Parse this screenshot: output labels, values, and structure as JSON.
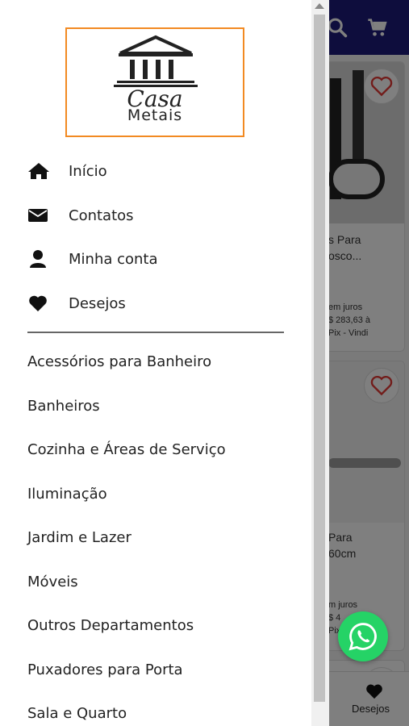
{
  "drawer": {
    "logo": {
      "line1": "Casa",
      "line2": "Metais",
      "border_color": "#f28a22"
    },
    "nav": [
      {
        "label": "Início",
        "icon": "home-icon"
      },
      {
        "label": "Contatos",
        "icon": "envelope-icon"
      },
      {
        "label": "Minha conta",
        "icon": "user-icon"
      },
      {
        "label": "Desejos",
        "icon": "heart-icon"
      }
    ],
    "categories": [
      "Acessórios para Banheiro",
      "Banheiros",
      "Cozinha e Áreas de Serviço",
      "Iluminação",
      "Jardim e Lazer",
      "Móveis",
      "Outros Departamentos",
      "Puxadores para Porta",
      "Sala e Quarto"
    ]
  },
  "background": {
    "header_color": "#1d1a7a",
    "card1": {
      "title_line1": "s Para",
      "title_line2": "osco...",
      "price_line1": "em juros",
      "price_line2": "$ 283,63 à",
      "price_line3": "Pix - Vindi"
    },
    "card2": {
      "title_line1": "Para",
      "title_line2": "60cm",
      "price_line1": "m juros",
      "price_line2": "$ 4",
      "price_line3": "Pix"
    },
    "bottom_nav_label": "Desejos"
  },
  "whatsapp_color": "#25d366"
}
